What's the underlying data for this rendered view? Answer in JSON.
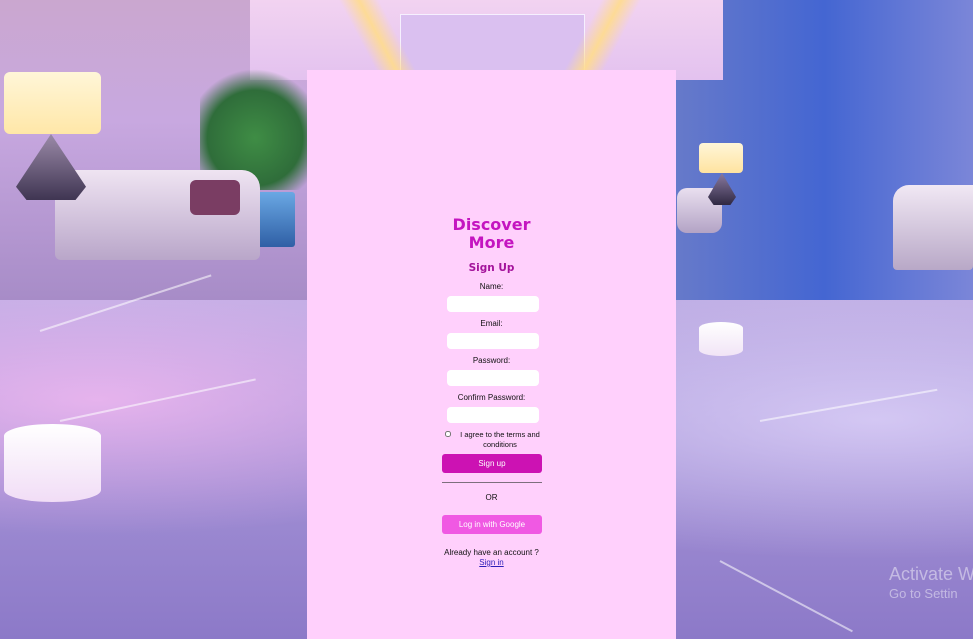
{
  "brand": {
    "line1": "Discover",
    "line2": "More"
  },
  "form": {
    "heading": "Sign Up",
    "name_label": "Name:",
    "email_label": "Email:",
    "password_label": "Password:",
    "confirm_password_label": "Confirm Password:",
    "terms_line1": "I agree to the terms and",
    "terms_line2": "conditions",
    "terms_checked": false,
    "signup_button": "Sign up",
    "divider_text": "OR",
    "google_button": "Log in with Google",
    "account_prompt": "Already have an account ?",
    "signin_link": "Sign in"
  },
  "watermark": {
    "line1": "Activate W",
    "line2": "Go to Settin"
  },
  "colors": {
    "panel_bg": "#ffd0fc",
    "brand": "#c415c0",
    "signup_button_bg": "#cc12b3",
    "google_button_bg": "#f059e3",
    "link": "#2d1fb8"
  }
}
